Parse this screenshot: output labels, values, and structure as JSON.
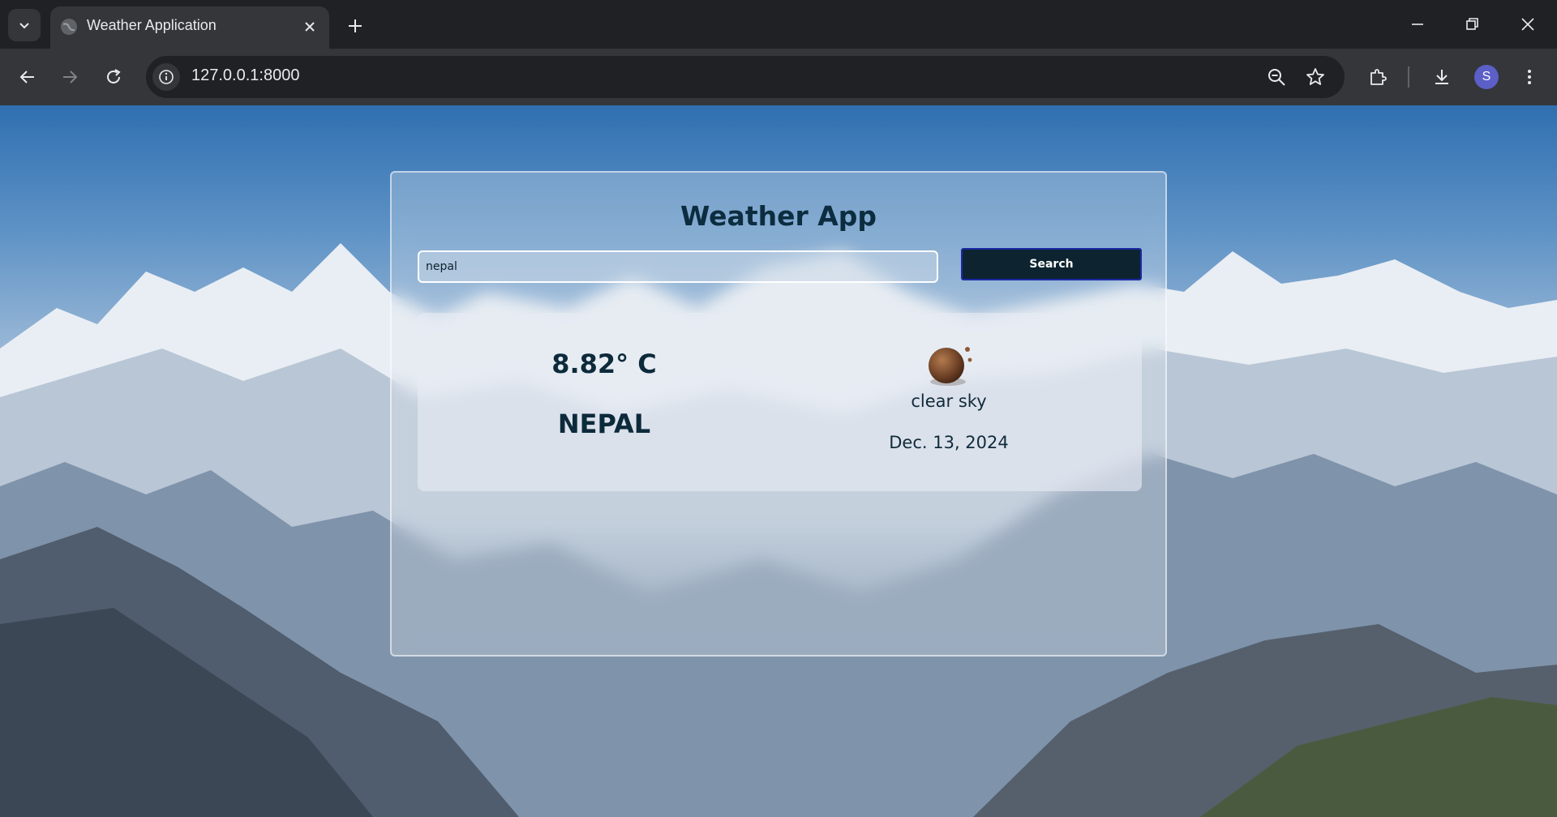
{
  "browser": {
    "tab_title": "Weather Application",
    "url": "127.0.0.1:8000",
    "profile_initial": "S"
  },
  "app": {
    "title": "Weather App",
    "search": {
      "value": "nepal",
      "placeholder": "",
      "button_label": "Search"
    },
    "result": {
      "temperature": "8.82° C",
      "city": "NEPAL",
      "description": "clear sky",
      "date": "Dec. 13, 2024",
      "icon": "clear-sky-icon"
    }
  },
  "colors": {
    "title": "#0c2d3f",
    "search_button_bg": "#0d2430",
    "search_button_border": "#1a2aa5"
  }
}
